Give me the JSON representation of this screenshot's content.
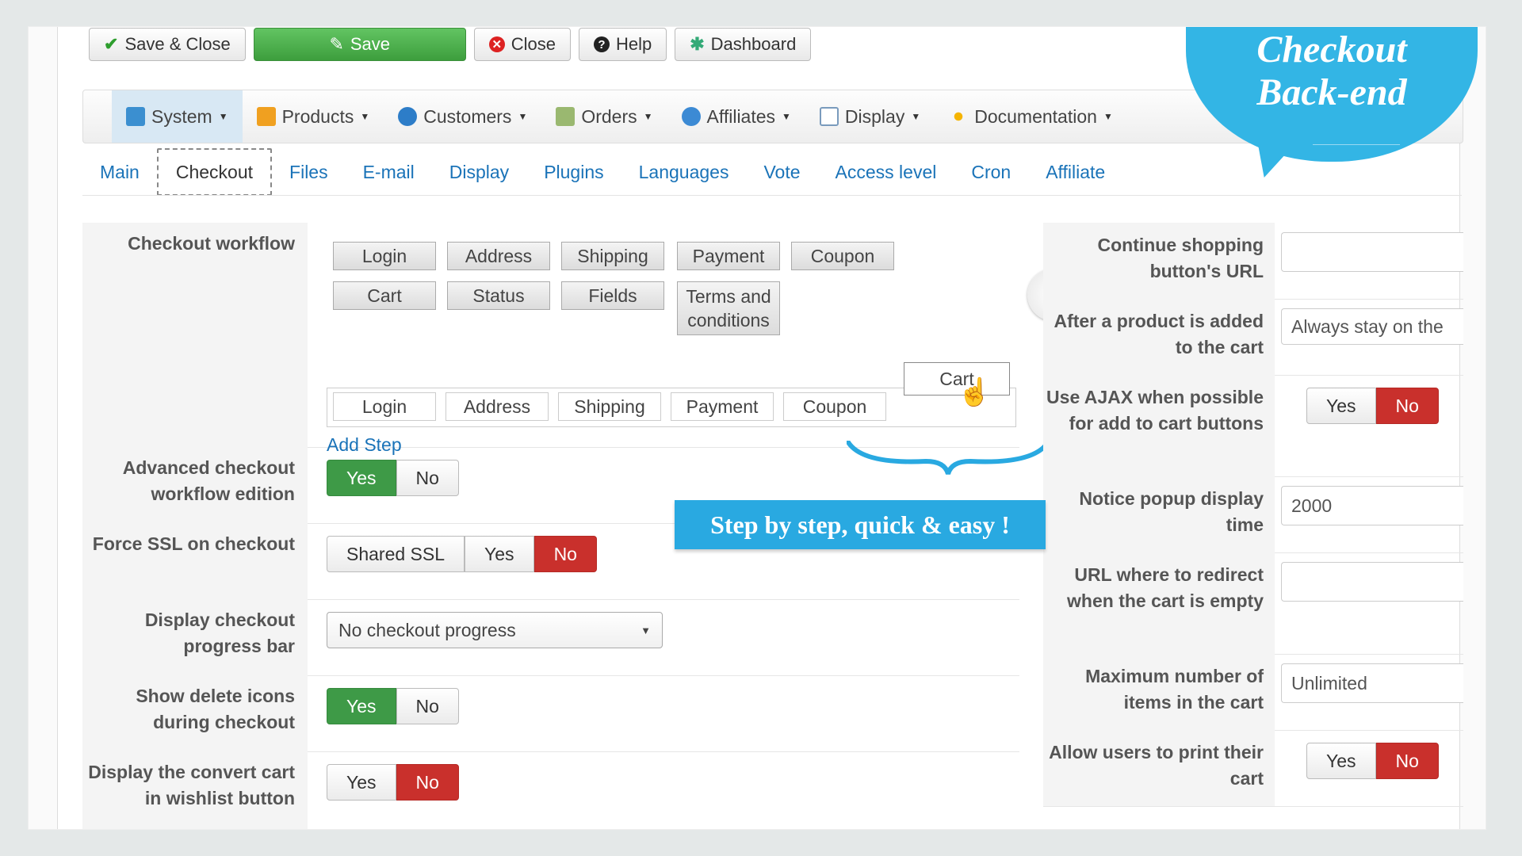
{
  "toolbar": {
    "save_close": "Save & Close",
    "save": "Save",
    "close": "Close",
    "help": "Help",
    "dashboard": "Dashboard"
  },
  "menu": {
    "items": [
      {
        "label": "System",
        "icon": "tools-icon"
      },
      {
        "label": "Products",
        "icon": "box-icon"
      },
      {
        "label": "Customers",
        "icon": "users-icon"
      },
      {
        "label": "Orders",
        "icon": "clipboard-icon"
      },
      {
        "label": "Affiliates",
        "icon": "affiliates-icon"
      },
      {
        "label": "Display",
        "icon": "display-icon"
      },
      {
        "label": "Documentation",
        "icon": "documentation-icon"
      }
    ]
  },
  "tabs": [
    "Main",
    "Checkout",
    "Files",
    "E-mail",
    "Display",
    "Plugins",
    "Languages",
    "Vote",
    "Access level",
    "Cron",
    "Affiliate"
  ],
  "callout": {
    "bubble_line1": "Checkout",
    "bubble_line2": "Back-end",
    "banner": "Step by step, quick & easy !"
  },
  "workflow": {
    "label": "Checkout workflow",
    "steps_row1": [
      "Login",
      "Address",
      "Shipping",
      "Payment",
      "Coupon"
    ],
    "steps_row2": [
      "Cart",
      "Status",
      "Fields",
      "Terms and conditions"
    ],
    "dragging": "Cart",
    "steps_row3": [
      "Login",
      "Address",
      "Shipping",
      "Payment",
      "Coupon"
    ],
    "add_step": "Add Step"
  },
  "left_rows": {
    "advanced": {
      "label": "Advanced checkout workflow edition",
      "yes": "Yes",
      "no": "No"
    },
    "ssl": {
      "label": "Force SSL on checkout",
      "shared": "Shared SSL",
      "yes": "Yes",
      "no": "No"
    },
    "progress": {
      "label": "Display checkout progress bar",
      "value": "No checkout progress"
    },
    "delete_icons": {
      "label": "Show delete icons during checkout",
      "yes": "Yes",
      "no": "No"
    },
    "wishlist": {
      "label": "Display the convert cart in wishlist button",
      "yes": "Yes",
      "no": "No"
    }
  },
  "right_rows": {
    "continue_url": {
      "label": "Continue shopping button's URL",
      "value": ""
    },
    "after_add": {
      "label": "After a product is added to the cart",
      "value": "Always stay on the"
    },
    "ajax": {
      "label": "Use AJAX when possible for add to cart buttons",
      "yes": "Yes",
      "no": "No"
    },
    "popup_time": {
      "label": "Notice popup display time",
      "value": "2000"
    },
    "redirect_url": {
      "label": "URL where to redirect when the cart is empty",
      "value": ""
    },
    "max_items": {
      "label": "Maximum number of items in the cart",
      "value": "Unlimited"
    },
    "print_cart": {
      "label": "Allow users to print their cart",
      "yes": "Yes",
      "no": "No"
    }
  }
}
